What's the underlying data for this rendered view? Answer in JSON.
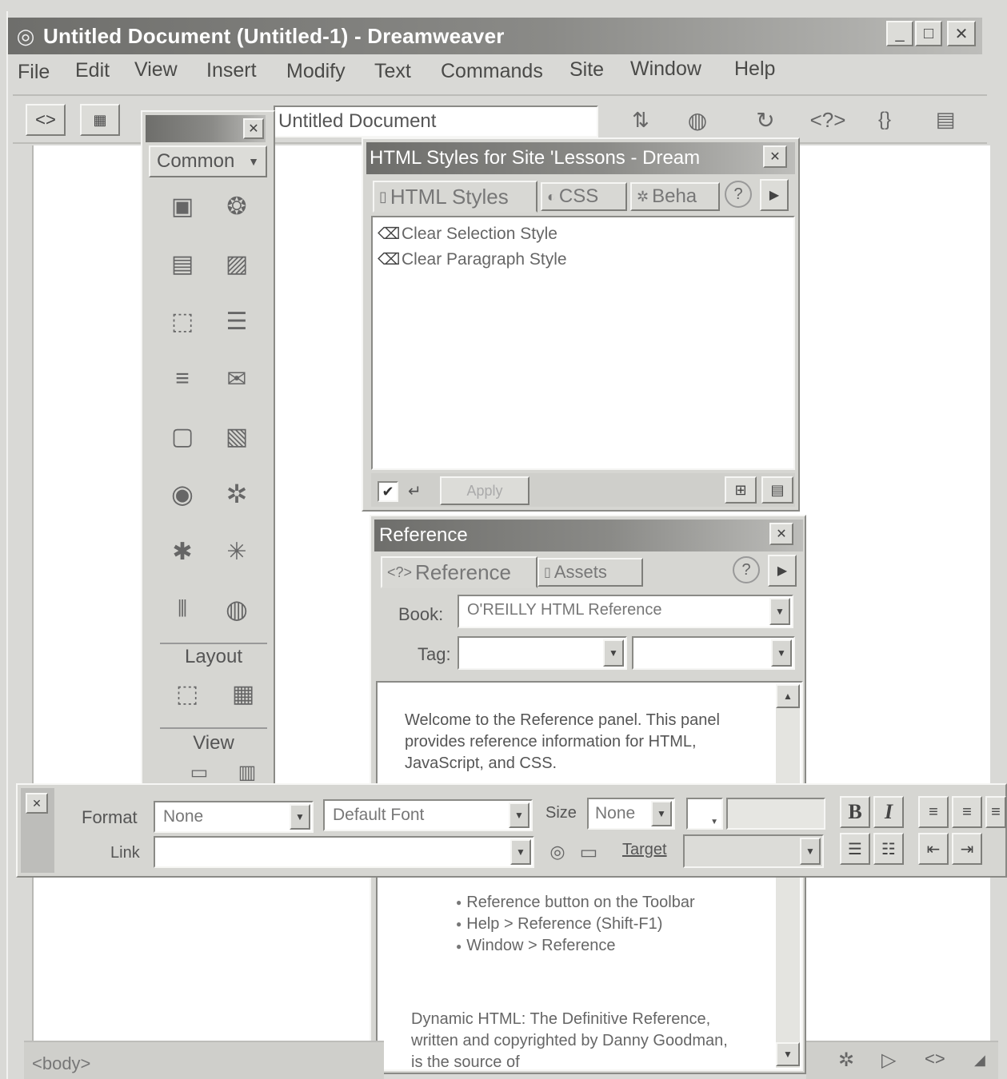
{
  "window": {
    "title": "Untitled Document (Untitled-1) - Dreamweaver",
    "controls": [
      "minimize-icon",
      "maximize-icon",
      "close-icon"
    ]
  },
  "menu": [
    "File",
    "Edit",
    "View",
    "Insert",
    "Modify",
    "Text",
    "Commands",
    "Site",
    "Window",
    "Help"
  ],
  "toolbar": {
    "doc_title": "Untitled Document",
    "icons": [
      "code-view-icon",
      "split-view-icon",
      "file-management-icon",
      "preview-globe-icon",
      "refresh-icon",
      "reference-icon",
      "nav-options-icon",
      "view-options-icon"
    ]
  },
  "objects_panel": {
    "category": "Common",
    "layout_label": "Layout",
    "view_label": "View",
    "icons": [
      "insert-image-icon",
      "insert-rollover-icon",
      "insert-table-icon",
      "insert-tabular-data-icon",
      "insert-layer-icon",
      "insert-navbar-icon",
      "insert-hr-icon",
      "insert-email-link-icon",
      "insert-date-icon",
      "insert-fireworks-html-icon",
      "insert-flash-icon",
      "insert-shockwave-icon",
      "insert-flash-button-icon",
      "insert-flash-text-icon",
      "insert-generator-icon",
      "insert-applet-icon",
      "draw-layout-cell-icon",
      "draw-layout-table-icon",
      "standard-view-icon",
      "layout-view-icon"
    ]
  },
  "html_styles_panel": {
    "title": "HTML Styles for Site 'Lessons - Dream",
    "tabs": [
      "HTML Styles",
      "CSS",
      "Beha"
    ],
    "items": [
      "Clear Selection Style",
      "Clear Paragraph Style"
    ],
    "apply_label": "Apply"
  },
  "reference_panel": {
    "title": "Reference",
    "tabs": [
      "Reference",
      "Assets"
    ],
    "book_label": "Book:",
    "book_value": "O'REILLY HTML Reference",
    "tag_label": "Tag:",
    "intro": "Welcome to the Reference panel. This panel provides reference information for HTML, JavaScript, and CSS.",
    "bullets": [
      "Reference button on the Toolbar",
      "Help > Reference (Shift-F1)",
      "Window > Reference"
    ],
    "footer_text": "Dynamic HTML: The Definitive Reference, written and copyrighted by Danny Goodman, is the source of"
  },
  "property_inspector": {
    "format_label": "Format",
    "format_value": "None",
    "font_value": "Default Font",
    "size_label": "Size",
    "size_value": "None",
    "link_label": "Link",
    "target_label": "Target",
    "bold_label": "B",
    "italic_label": "I"
  },
  "status_bar": {
    "tag": "<body>"
  }
}
